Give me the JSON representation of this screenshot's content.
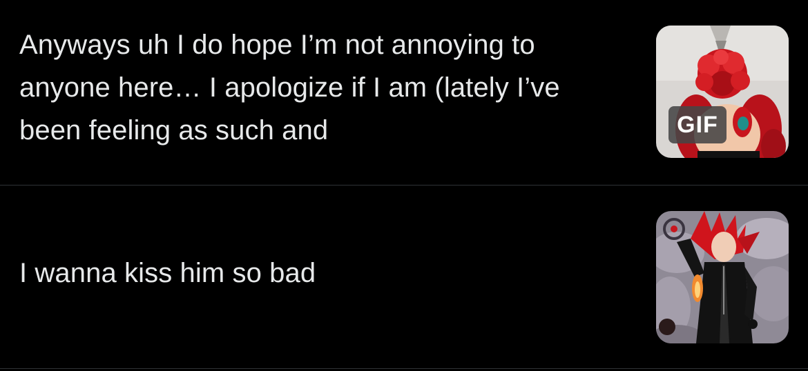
{
  "feed": {
    "posts": [
      {
        "text": "Anyways uh I do hope I’m not annoying to anyone here… I apologize if I am (lately I’ve been feeling as such and",
        "media": {
          "type": "gif",
          "badge": "GIF",
          "subject": "red-haired figure with red frosting"
        }
      },
      {
        "text": "I wanna kiss him so bad",
        "media": {
          "type": "image",
          "subject": "red-haired character in black coat"
        }
      }
    ]
  },
  "colors": {
    "background": "#000000",
    "text": "#e7e9ea",
    "divider": "#2f3336",
    "accent_red": "#c8161e"
  }
}
